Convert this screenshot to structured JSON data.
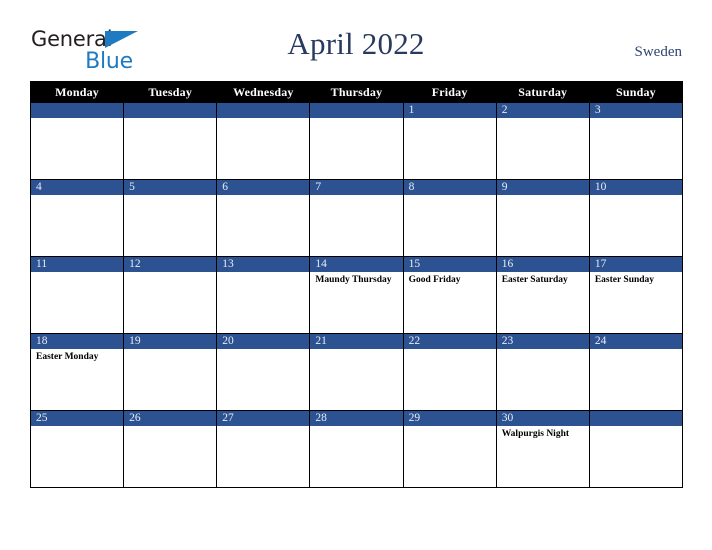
{
  "brand": {
    "name_part1": "General",
    "name_part2": "Blue",
    "triangle_icon": "blue-triangle-icon",
    "accent_color": "#1f7bc1",
    "text_color": "#231f20"
  },
  "header": {
    "title": "April 2022",
    "country": "Sweden",
    "title_color": "#283a5e"
  },
  "calendar": {
    "month": "April",
    "year": "2022",
    "header_bg": "#000000",
    "daybar_bg": "#2d5291",
    "weekdays": [
      "Monday",
      "Tuesday",
      "Wednesday",
      "Thursday",
      "Friday",
      "Saturday",
      "Sunday"
    ],
    "weeks": [
      [
        {
          "day": "",
          "holiday": ""
        },
        {
          "day": "",
          "holiday": ""
        },
        {
          "day": "",
          "holiday": ""
        },
        {
          "day": "",
          "holiday": ""
        },
        {
          "day": "1",
          "holiday": ""
        },
        {
          "day": "2",
          "holiday": ""
        },
        {
          "day": "3",
          "holiday": ""
        }
      ],
      [
        {
          "day": "4",
          "holiday": ""
        },
        {
          "day": "5",
          "holiday": ""
        },
        {
          "day": "6",
          "holiday": ""
        },
        {
          "day": "7",
          "holiday": ""
        },
        {
          "day": "8",
          "holiday": ""
        },
        {
          "day": "9",
          "holiday": ""
        },
        {
          "day": "10",
          "holiday": ""
        }
      ],
      [
        {
          "day": "11",
          "holiday": ""
        },
        {
          "day": "12",
          "holiday": ""
        },
        {
          "day": "13",
          "holiday": ""
        },
        {
          "day": "14",
          "holiday": "Maundy Thursday"
        },
        {
          "day": "15",
          "holiday": "Good Friday"
        },
        {
          "day": "16",
          "holiday": "Easter Saturday"
        },
        {
          "day": "17",
          "holiday": "Easter Sunday"
        }
      ],
      [
        {
          "day": "18",
          "holiday": "Easter Monday"
        },
        {
          "day": "19",
          "holiday": ""
        },
        {
          "day": "20",
          "holiday": ""
        },
        {
          "day": "21",
          "holiday": ""
        },
        {
          "day": "22",
          "holiday": ""
        },
        {
          "day": "23",
          "holiday": ""
        },
        {
          "day": "24",
          "holiday": ""
        }
      ],
      [
        {
          "day": "25",
          "holiday": ""
        },
        {
          "day": "26",
          "holiday": ""
        },
        {
          "day": "27",
          "holiday": ""
        },
        {
          "day": "28",
          "holiday": ""
        },
        {
          "day": "29",
          "holiday": ""
        },
        {
          "day": "30",
          "holiday": "Walpurgis Night"
        },
        {
          "day": "",
          "holiday": ""
        }
      ]
    ]
  }
}
